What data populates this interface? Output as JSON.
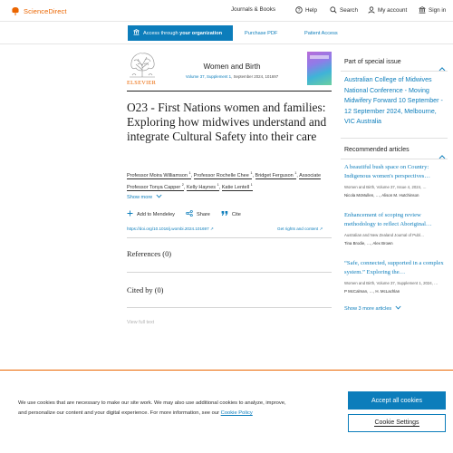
{
  "header": {
    "logo_text": "ScienceDirect",
    "nav": [
      {
        "label": "Journals & Books"
      },
      {
        "label": "Help"
      },
      {
        "label": "Search"
      },
      {
        "label": "My account"
      },
      {
        "label": "Sign in"
      }
    ]
  },
  "access_bar": {
    "access_prefix": "Access through ",
    "access_bold": "your organization",
    "purchase_pdf": "Purchase PDF",
    "patient_access": "Patient Access"
  },
  "journal": {
    "publisher": "ELSEVIER",
    "title": "Women and Birth",
    "volume_link": "Volume 37, Supplement 1",
    "date_pages": ", September 2024, 101697"
  },
  "article": {
    "title": "O23 - First Nations women and families: Exploring how midwives understand and integrate Cultural Safety into their care",
    "authors": [
      {
        "name": "Professor Moira Williamson",
        "sup": "1"
      },
      {
        "name": "Professor Rochelle Chee",
        "sup": "1"
      },
      {
        "name": "Bridget Ferguson",
        "sup": "1"
      },
      {
        "name": "Associate Professor Tonya Capper",
        "sup": "2"
      },
      {
        "name": "Kelly Haynes",
        "sup": "1"
      },
      {
        "name": "Katie Lentell",
        "sup": "1"
      }
    ],
    "show_more": "Show more",
    "actions": {
      "mendeley": "Add to Mendeley",
      "share": "Share",
      "cite": "Cite"
    },
    "doi": "https://doi.org/10.1016/j.wombi.2024.101697 ↗",
    "rights": "Get rights and content ↗",
    "references": "References (0)",
    "cited_by": "Cited by (0)",
    "view_full_text": "View full text"
  },
  "sidebar": {
    "special_issue_heading": "Part of special issue",
    "special_issue_link": "Australian College of Midwives National Conference - Moving Midwifery Forward 10 September - 12 September 2024, Melbourne, VIC Australia",
    "recommended_heading": "Recommended articles",
    "recommended": [
      {
        "title": "A beautiful bush space on Country: Indigenous women's perspectives…",
        "meta": "Women and Birth, Volume 37, Issue 4, 2024, …",
        "authors": "Nicola McMullen, …, Alison M. Hutchinson"
      },
      {
        "title": "Enhancement of scoping review methodology to reflect Aboriginal…",
        "meta": "Australian and New Zealand Journal of Publ…",
        "authors": "Tina Brodie, …, Alex Brown"
      },
      {
        "title": "“Safe, connected, supported in a complex system.” Exploring the…",
        "meta": "Women and Birth, Volume 37, Supplement 1, 2024, …",
        "authors": "P McCalman, …, H. McLachlan"
      }
    ],
    "show_more_articles": "Show 3 more articles"
  },
  "cookie_banner": {
    "text": "We use cookies that are necessary to make our site work. We may also use additional cookies to analyze, improve, and personalize our content and your digital experience. For more information, see our ",
    "policy_link": "Cookie Policy",
    "accept_label": "Accept all cookies",
    "settings_label": "Cookie Settings"
  },
  "colors": {
    "brand_orange": "#eb6500",
    "link_blue": "#0c7dbb"
  }
}
